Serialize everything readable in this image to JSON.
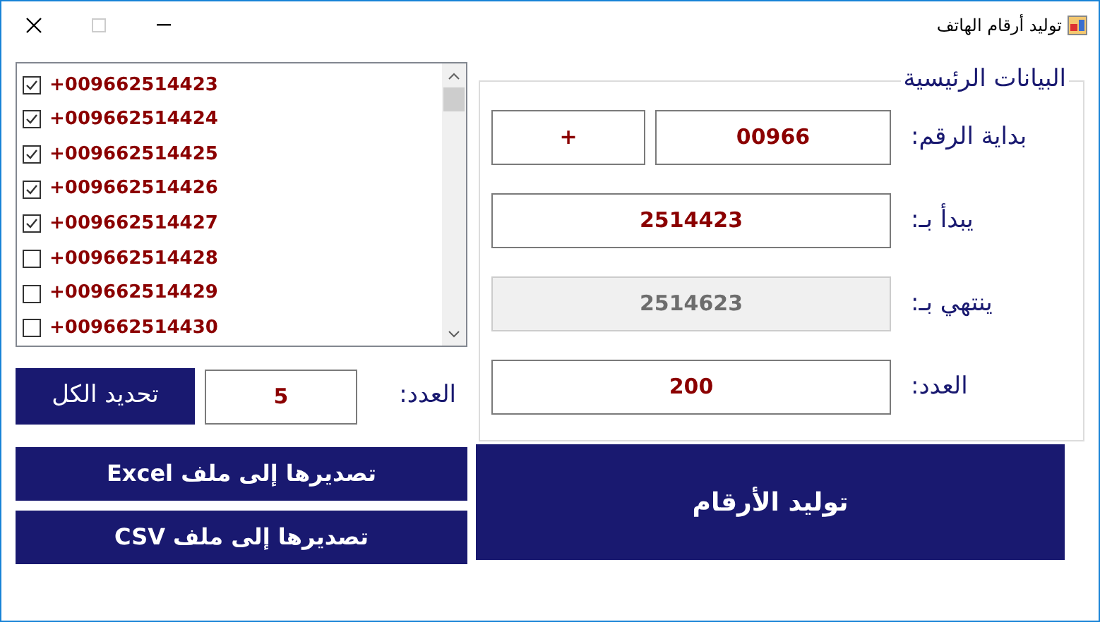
{
  "window": {
    "title": "توليد أرقام الهاتف"
  },
  "numbers_list": {
    "items": [
      {
        "text": "+009662514423",
        "checked": true
      },
      {
        "text": "+009662514424",
        "checked": true
      },
      {
        "text": "+009662514425",
        "checked": true
      },
      {
        "text": "+009662514426",
        "checked": true
      },
      {
        "text": "+009662514427",
        "checked": true
      },
      {
        "text": "+009662514428",
        "checked": false
      },
      {
        "text": "+009662514429",
        "checked": false
      },
      {
        "text": "+009662514430",
        "checked": false
      }
    ]
  },
  "selection": {
    "label": "العدد:",
    "value": "5",
    "button": "تحديد الكل"
  },
  "export_buttons": [
    "تصديرها إلى ملف Excel",
    "تصديرها إلى ملف CSV"
  ],
  "main_data": {
    "title": "البيانات الرئيسية",
    "fields": [
      {
        "label": "بداية الرقم:",
        "inputs": [
          {
            "value": "00966",
            "disabled": false
          },
          {
            "value": "+",
            "disabled": false
          }
        ]
      },
      {
        "label": "يبدأ بـ:",
        "inputs": [
          {
            "value": "2514423",
            "disabled": false
          }
        ]
      },
      {
        "label": "ينتهي بـ:",
        "inputs": [
          {
            "value": "2514623",
            "disabled": true
          }
        ]
      },
      {
        "label": "العدد:",
        "inputs": [
          {
            "value": "200",
            "disabled": false
          }
        ]
      }
    ]
  },
  "generate_button": "توليد الأرقام"
}
